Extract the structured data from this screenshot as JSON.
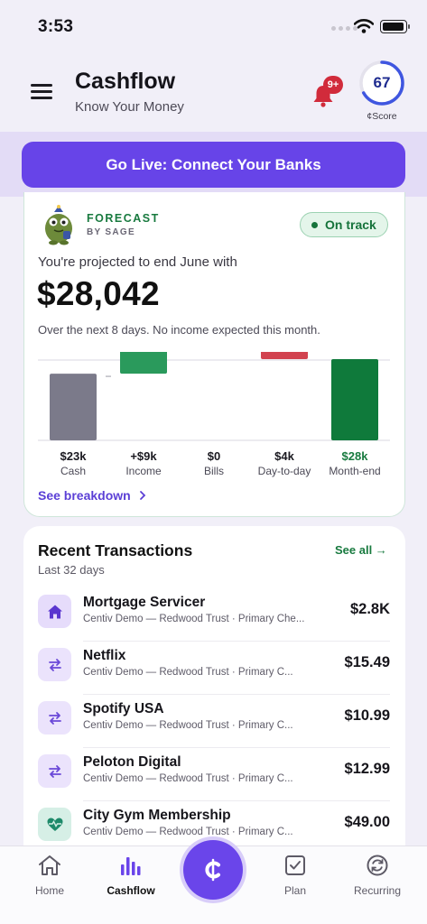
{
  "status_bar": {
    "time": "3:53"
  },
  "header": {
    "title": "Cashflow",
    "subtitle": "Know Your Money",
    "notification_badge": "9+",
    "score": "67",
    "score_fraction": 0.67,
    "score_label": "¢Score"
  },
  "banner": {
    "go_live_label": "Go Live: Connect Your Banks"
  },
  "forecast": {
    "title": "FORECAST",
    "by": "BY SAGE",
    "status": "On track",
    "projection_text": "You're projected to end June with",
    "projection_amount": "$28,042",
    "note": "Over the next 8 days. No income expected this month.",
    "breakdown_label": "See breakdown",
    "colors": {
      "cash": "#7b7a8a",
      "income": "#2a9a5c",
      "bills": "#d2424f",
      "month_end": "#0f7a3b",
      "accent": "#5b3fd6"
    }
  },
  "chart_data": {
    "type": "waterfall",
    "categories": [
      "Cash",
      "Income",
      "Bills",
      "Day-to-day",
      "Month-end"
    ],
    "values": [
      23,
      9,
      0,
      -4,
      28
    ],
    "value_labels": [
      "$23k",
      "+$9k",
      "$0",
      "$4k",
      "$28k"
    ],
    "unit": "thousands USD"
  },
  "transactions": {
    "title": "Recent Transactions",
    "subtitle": "Last 32 days",
    "see_all": "See all →",
    "items": [
      {
        "name": "Mortgage Servicer",
        "meta": "Centiv Demo — Redwood Trust · Primary Che...",
        "amount": "$2.8K",
        "icon": "house-icon"
      },
      {
        "name": "Netflix",
        "meta": "Centiv Demo — Redwood Trust · Primary C...",
        "amount": "$15.49",
        "icon": "recurring-arrows-icon"
      },
      {
        "name": "Spotify USA",
        "meta": "Centiv Demo — Redwood Trust · Primary C...",
        "amount": "$10.99",
        "icon": "recurring-arrows-icon"
      },
      {
        "name": "Peloton Digital",
        "meta": "Centiv Demo — Redwood Trust · Primary C...",
        "amount": "$12.99",
        "icon": "recurring-arrows-icon"
      },
      {
        "name": "City Gym Membership",
        "meta": "Centiv Demo — Redwood Trust · Primary C...",
        "amount": "$49.00",
        "icon": "heartbeat-icon"
      }
    ]
  },
  "tab_bar": {
    "items": [
      {
        "label": "Home",
        "icon": "home-icon"
      },
      {
        "label": "Cashflow",
        "icon": "bar-chart-icon",
        "active": true
      },
      {
        "label": "Plan",
        "icon": "checkbox-icon"
      },
      {
        "label": "Recurring",
        "icon": "recurring-icon"
      }
    ],
    "center_icon": "cent-icon"
  }
}
